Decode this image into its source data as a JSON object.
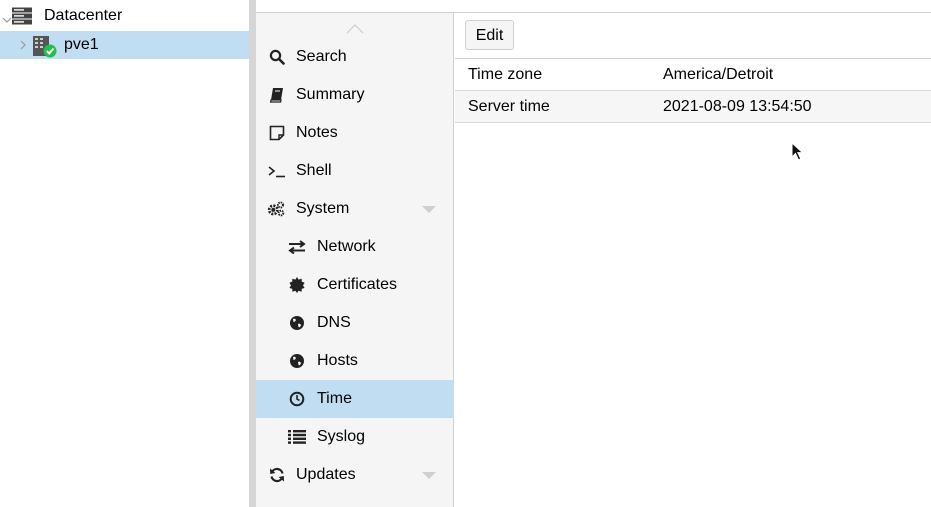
{
  "tree": {
    "datacenter": {
      "label": "Datacenter",
      "icon": "server-stack-icon"
    },
    "node": {
      "label": "pve1",
      "icon": "node-online-icon",
      "selected": true
    }
  },
  "nav": {
    "items": [
      {
        "label": "Search",
        "icon": "search-icon"
      },
      {
        "label": "Summary",
        "icon": "book-icon"
      },
      {
        "label": "Notes",
        "icon": "note-icon"
      },
      {
        "label": "Shell",
        "icon": "terminal-icon"
      },
      {
        "label": "System",
        "icon": "gears-icon",
        "expanded": true
      },
      {
        "label": "Network",
        "icon": "exchange-icon"
      },
      {
        "label": "Certificates",
        "icon": "certificate-icon"
      },
      {
        "label": "DNS",
        "icon": "globe-icon"
      },
      {
        "label": "Hosts",
        "icon": "globe-icon"
      },
      {
        "label": "Time",
        "icon": "clock-icon",
        "selected": true
      },
      {
        "label": "Syslog",
        "icon": "list-icon"
      },
      {
        "label": "Updates",
        "icon": "refresh-icon"
      }
    ]
  },
  "toolbar": {
    "edit_label": "Edit"
  },
  "time_grid": {
    "rows": [
      {
        "key": "Time zone",
        "value": "America/Detroit"
      },
      {
        "key": "Server time",
        "value": "2021-08-09 13:54:50"
      }
    ]
  },
  "colors": {
    "selected_bg": "#c1ddf1",
    "nav_bg": "#f5f5f5",
    "status_ok": "#21bf4b"
  }
}
